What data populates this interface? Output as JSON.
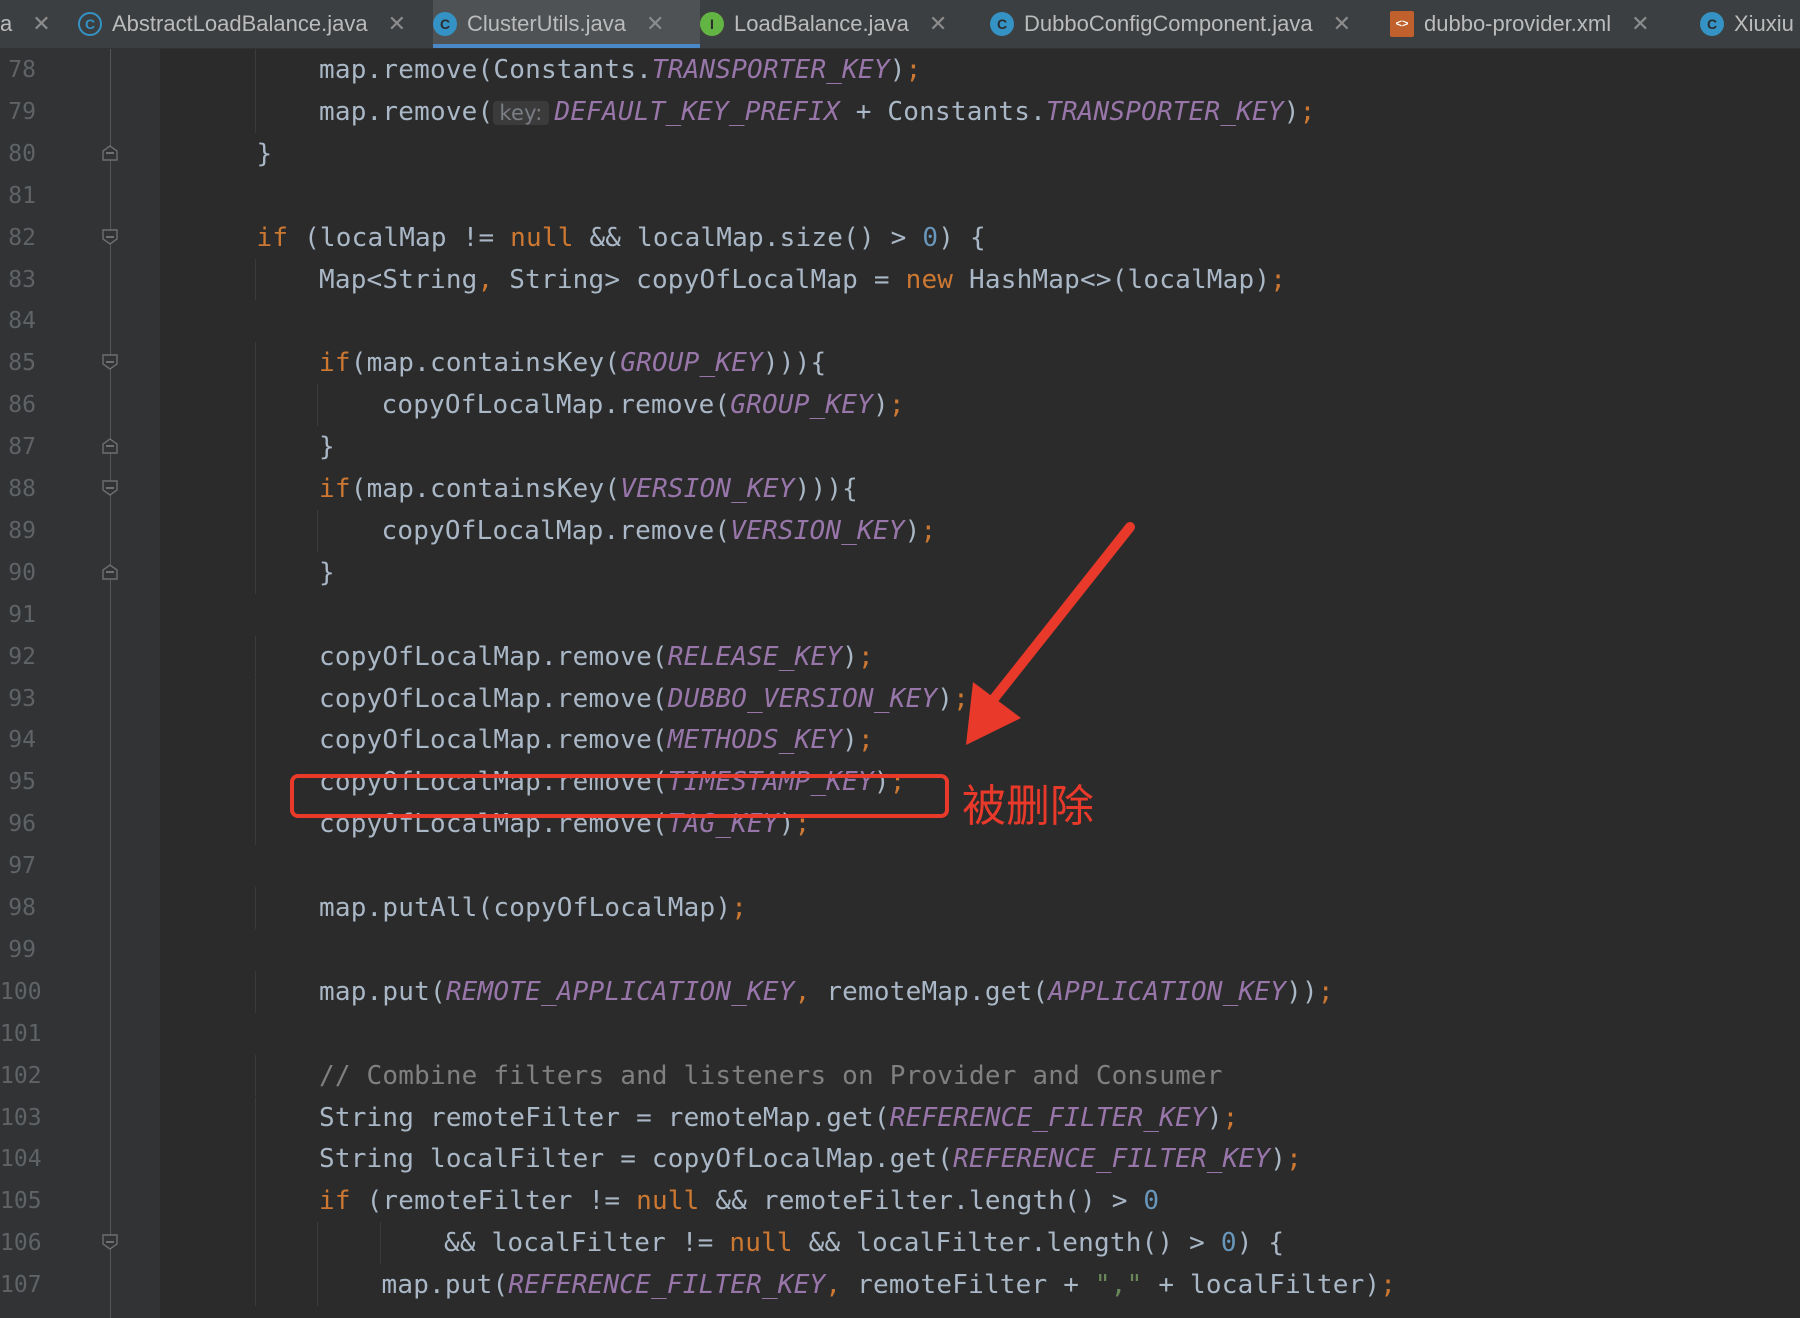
{
  "tabs": [
    {
      "label": "a",
      "icon": "",
      "active": false
    },
    {
      "label": "AbstractLoadBalance.java",
      "icon": "abstract-class-icon",
      "active": false
    },
    {
      "label": "ClusterUtils.java",
      "icon": "class-icon",
      "active": true
    },
    {
      "label": "LoadBalance.java",
      "icon": "interface-icon",
      "active": false
    },
    {
      "label": "DubboConfigComponent.java",
      "icon": "class-icon",
      "active": false
    },
    {
      "label": "dubbo-provider.xml",
      "icon": "xml-file-icon",
      "active": false
    },
    {
      "label": "Xiuxiu",
      "icon": "class-icon",
      "active": false
    }
  ],
  "colors": {
    "background": "#2b2b2b",
    "keyword": "#cc7832",
    "constant": "#9876aa",
    "number": "#6897bb",
    "string": "#6a8759",
    "comment": "#808080",
    "annotation": "#e8392a",
    "active_tab_underline": "#4a88c7"
  },
  "code_lines": [
    {
      "n": "78",
      "fold": "",
      "indent": 2,
      "segs": [
        [
          "p",
          "map.remove(Constants."
        ],
        [
          "c",
          "TRANSPORTER_KEY"
        ],
        [
          "p",
          ")"
        ],
        [
          "k",
          ";"
        ]
      ]
    },
    {
      "n": "79",
      "fold": "",
      "indent": 2,
      "segs": [
        [
          "p",
          "map.remove("
        ],
        [
          "h",
          "key:"
        ],
        [
          "c",
          "DEFAULT_KEY_PREFIX"
        ],
        [
          "p",
          " + Constants."
        ],
        [
          "c",
          "TRANSPORTER_KEY"
        ],
        [
          "p",
          ")"
        ],
        [
          "k",
          ";"
        ]
      ]
    },
    {
      "n": "80",
      "fold": "end",
      "indent": 1,
      "segs": [
        [
          "p",
          "}"
        ]
      ]
    },
    {
      "n": "81",
      "fold": "",
      "indent": 0,
      "segs": []
    },
    {
      "n": "82",
      "fold": "start",
      "indent": 1,
      "segs": [
        [
          "k",
          "if"
        ],
        [
          "p",
          " (localMap != "
        ],
        [
          "k",
          "null"
        ],
        [
          "p",
          " && localMap.size() > "
        ],
        [
          "n",
          "0"
        ],
        [
          "p",
          ") {"
        ]
      ]
    },
    {
      "n": "83",
      "fold": "",
      "indent": 2,
      "segs": [
        [
          "p",
          "Map<String"
        ],
        [
          "k",
          ","
        ],
        [
          "p",
          " String> copyOfLocalMap = "
        ],
        [
          "k",
          "new"
        ],
        [
          "p",
          " HashMap<>(localMap)"
        ],
        [
          "k",
          ";"
        ]
      ]
    },
    {
      "n": "84",
      "fold": "",
      "indent": 0,
      "segs": []
    },
    {
      "n": "85",
      "fold": "start",
      "indent": 2,
      "segs": [
        [
          "k",
          "if"
        ],
        [
          "p",
          "(map.containsKey("
        ],
        [
          "c",
          "GROUP_KEY"
        ],
        [
          "p",
          "))){"
        ]
      ]
    },
    {
      "n": "86",
      "fold": "",
      "indent": 3,
      "segs": [
        [
          "p",
          "copyOfLocalMap.remove("
        ],
        [
          "c",
          "GROUP_KEY"
        ],
        [
          "p",
          ")"
        ],
        [
          "k",
          ";"
        ]
      ]
    },
    {
      "n": "87",
      "fold": "end",
      "indent": 2,
      "segs": [
        [
          "p",
          "}"
        ]
      ]
    },
    {
      "n": "88",
      "fold": "start",
      "indent": 2,
      "segs": [
        [
          "k",
          "if"
        ],
        [
          "p",
          "(map.containsKey("
        ],
        [
          "c",
          "VERSION_KEY"
        ],
        [
          "p",
          "))){"
        ]
      ]
    },
    {
      "n": "89",
      "fold": "",
      "indent": 3,
      "segs": [
        [
          "p",
          "copyOfLocalMap.remove("
        ],
        [
          "c",
          "VERSION_KEY"
        ],
        [
          "p",
          ")"
        ],
        [
          "k",
          ";"
        ]
      ]
    },
    {
      "n": "90",
      "fold": "end",
      "indent": 2,
      "segs": [
        [
          "p",
          "}"
        ]
      ]
    },
    {
      "n": "91",
      "fold": "",
      "indent": 0,
      "segs": []
    },
    {
      "n": "92",
      "fold": "",
      "indent": 2,
      "segs": [
        [
          "p",
          "copyOfLocalMap.remove("
        ],
        [
          "c",
          "RELEASE_KEY"
        ],
        [
          "p",
          ")"
        ],
        [
          "k",
          ";"
        ]
      ]
    },
    {
      "n": "93",
      "fold": "",
      "indent": 2,
      "segs": [
        [
          "p",
          "copyOfLocalMap.remove("
        ],
        [
          "c",
          "DUBBO_VERSION_KEY"
        ],
        [
          "p",
          ")"
        ],
        [
          "k",
          ";"
        ]
      ]
    },
    {
      "n": "94",
      "fold": "",
      "indent": 2,
      "segs": [
        [
          "p",
          "copyOfLocalMap.remove("
        ],
        [
          "c",
          "METHODS_KEY"
        ],
        [
          "p",
          ")"
        ],
        [
          "k",
          ";"
        ]
      ]
    },
    {
      "n": "95",
      "fold": "",
      "indent": 2,
      "segs": [
        [
          "p",
          "copyOfLocalMap.remove("
        ],
        [
          "c",
          "TIMESTAMP_KEY"
        ],
        [
          "p",
          ")"
        ],
        [
          "k",
          ";"
        ]
      ]
    },
    {
      "n": "96",
      "fold": "",
      "indent": 2,
      "segs": [
        [
          "p",
          "copyOfLocalMap.remove("
        ],
        [
          "c",
          "TAG_KEY"
        ],
        [
          "p",
          ")"
        ],
        [
          "k",
          ";"
        ]
      ]
    },
    {
      "n": "97",
      "fold": "",
      "indent": 0,
      "segs": []
    },
    {
      "n": "98",
      "fold": "",
      "indent": 2,
      "segs": [
        [
          "p",
          "map.putAll(copyOfLocalMap)"
        ],
        [
          "k",
          ";"
        ]
      ]
    },
    {
      "n": "99",
      "fold": "",
      "indent": 0,
      "segs": []
    },
    {
      "n": "100",
      "fold": "",
      "indent": 2,
      "segs": [
        [
          "p",
          "map.put("
        ],
        [
          "c",
          "REMOTE_APPLICATION_KEY"
        ],
        [
          "k",
          ","
        ],
        [
          "p",
          " remoteMap.get("
        ],
        [
          "c",
          "APPLICATION_KEY"
        ],
        [
          "p",
          "))"
        ],
        [
          "k",
          ";"
        ]
      ]
    },
    {
      "n": "101",
      "fold": "",
      "indent": 0,
      "segs": []
    },
    {
      "n": "102",
      "fold": "",
      "indent": 2,
      "segs": [
        [
          "m",
          "// Combine filters and listeners on Provider and Consumer"
        ]
      ]
    },
    {
      "n": "103",
      "fold": "",
      "indent": 2,
      "segs": [
        [
          "p",
          "String remoteFilter = remoteMap.get("
        ],
        [
          "c",
          "REFERENCE_FILTER_KEY"
        ],
        [
          "p",
          ")"
        ],
        [
          "k",
          ";"
        ]
      ]
    },
    {
      "n": "104",
      "fold": "",
      "indent": 2,
      "segs": [
        [
          "p",
          "String localFilter = copyOfLocalMap.get("
        ],
        [
          "c",
          "REFERENCE_FILTER_KEY"
        ],
        [
          "p",
          ")"
        ],
        [
          "k",
          ";"
        ]
      ]
    },
    {
      "n": "105",
      "fold": "",
      "indent": 2,
      "segs": [
        [
          "k",
          "if"
        ],
        [
          "p",
          " (remoteFilter != "
        ],
        [
          "k",
          "null"
        ],
        [
          "p",
          " && remoteFilter.length() > "
        ],
        [
          "n",
          "0"
        ]
      ]
    },
    {
      "n": "106",
      "fold": "start",
      "indent": 4,
      "segs": [
        [
          "p",
          "&& localFilter != "
        ],
        [
          "k",
          "null"
        ],
        [
          "p",
          " && localFilter.length() > "
        ],
        [
          "n",
          "0"
        ],
        [
          "p",
          ") {"
        ]
      ]
    },
    {
      "n": "107",
      "fold": "",
      "indent": 3,
      "segs": [
        [
          "p",
          "map.put("
        ],
        [
          "c",
          "REFERENCE_FILTER_KEY"
        ],
        [
          "k",
          ","
        ],
        [
          "p",
          " remoteFilter + "
        ],
        [
          "s",
          "\",\""
        ],
        [
          "p",
          " + localFilter)"
        ],
        [
          "k",
          ";"
        ]
      ]
    }
  ],
  "annotation": {
    "label": "被删除",
    "target_line": "95"
  }
}
